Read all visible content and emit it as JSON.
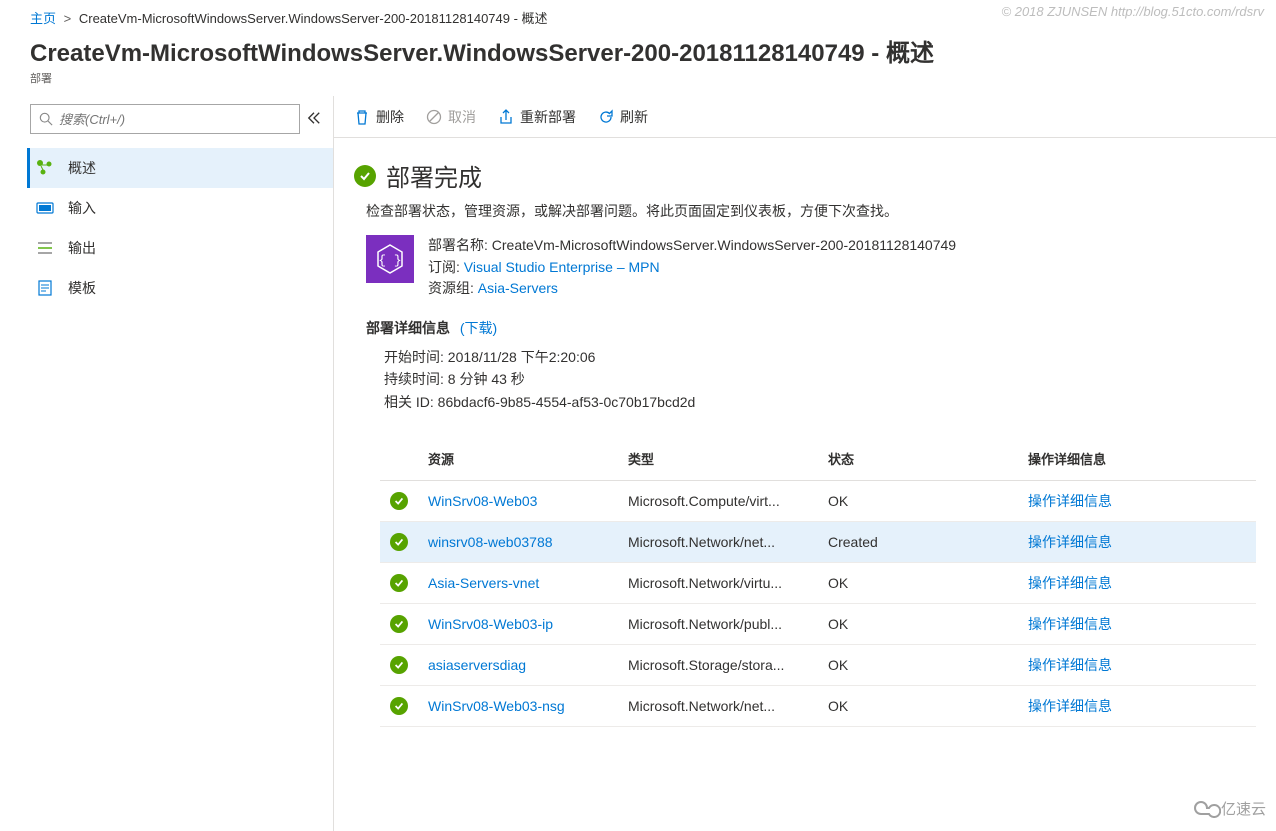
{
  "watermark": "© 2018 ZJUNSEN http://blog.51cto.com/rdsrv",
  "logo_text": "亿速云",
  "breadcrumb": {
    "home": "主页",
    "current": "CreateVm-MicrosoftWindowsServer.WindowsServer-200-20181128140749 - 概述"
  },
  "page": {
    "title": "CreateVm-MicrosoftWindowsServer.WindowsServer-200-20181128140749 - 概述",
    "subtitle": "部署"
  },
  "sidebar": {
    "search_placeholder": "搜索(Ctrl+/)",
    "items": [
      {
        "label": "概述"
      },
      {
        "label": "输入"
      },
      {
        "label": "输出"
      },
      {
        "label": "模板"
      }
    ]
  },
  "toolbar": {
    "delete": "删除",
    "cancel": "取消",
    "redeploy": "重新部署",
    "refresh": "刷新"
  },
  "status": {
    "title": "部署完成",
    "description": "检查部署状态，管理资源，或解决部署问题。将此页面固定到仪表板，方便下次查找。"
  },
  "deploy": {
    "name_label": "部署名称:",
    "name_value": "CreateVm-MicrosoftWindowsServer.WindowsServer-200-20181128140749",
    "sub_label": "订阅:",
    "sub_value": "Visual Studio Enterprise – MPN",
    "rg_label": "资源组:",
    "rg_value": "Asia-Servers"
  },
  "details_section": {
    "title": "部署详细信息",
    "download": "(下载)",
    "start_label": "开始时间:",
    "start_value": "2018/11/28 下午2:20:06",
    "duration_label": "持续时间:",
    "duration_value": "8 分钟 43 秒",
    "corr_label": "相关 ID:",
    "corr_value": "86bdacf6-9b85-4554-af53-0c70b17bcd2d"
  },
  "table": {
    "headers": {
      "resource": "资源",
      "type": "类型",
      "state": "状态",
      "details": "操作详细信息"
    },
    "details_link": "操作详细信息",
    "rows": [
      {
        "resource": "WinSrv08-Web03",
        "type": "Microsoft.Compute/virt...",
        "state": "OK"
      },
      {
        "resource": "winsrv08-web03788",
        "type": "Microsoft.Network/net...",
        "state": "Created"
      },
      {
        "resource": "Asia-Servers-vnet",
        "type": "Microsoft.Network/virtu...",
        "state": "OK"
      },
      {
        "resource": "WinSrv08-Web03-ip",
        "type": "Microsoft.Network/publ...",
        "state": "OK"
      },
      {
        "resource": "asiaserversdiag",
        "type": "Microsoft.Storage/stora...",
        "state": "OK"
      },
      {
        "resource": "WinSrv08-Web03-nsg",
        "type": "Microsoft.Network/net...",
        "state": "OK"
      }
    ]
  }
}
